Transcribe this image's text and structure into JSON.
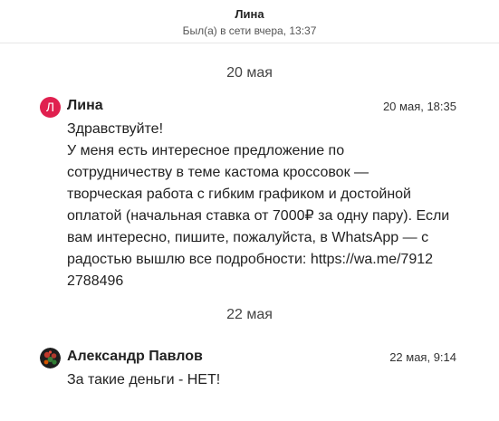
{
  "header": {
    "contact_name": "Лина",
    "status": "Был(а) в сети вчера, 13:37"
  },
  "conversation": [
    {
      "date_label": "20 мая",
      "message": {
        "avatar_letter": "Л",
        "avatar_color": "#e0204f",
        "sender": "Лина",
        "time": "20 мая, 18:35",
        "text": "Здравствуйте!\nУ меня есть интересное предложение по\nсотрудничеству в теме кастома кроссовок —\nтворческая работа с гибким графиком и достойной\nоплатой (начальная ставка от 7000₽ за одну пару). Если\nвам интересно, пишите, пожалуйста, в WhatsApp — с\nрадостью вышлю все подробности: https://wa.me/7912\n2788496"
      }
    },
    {
      "date_label": "22 мая",
      "message": {
        "sender": "Александр Павлов",
        "time": "22 мая, 9:14",
        "text": "За такие деньги - НЕТ!"
      }
    }
  ]
}
